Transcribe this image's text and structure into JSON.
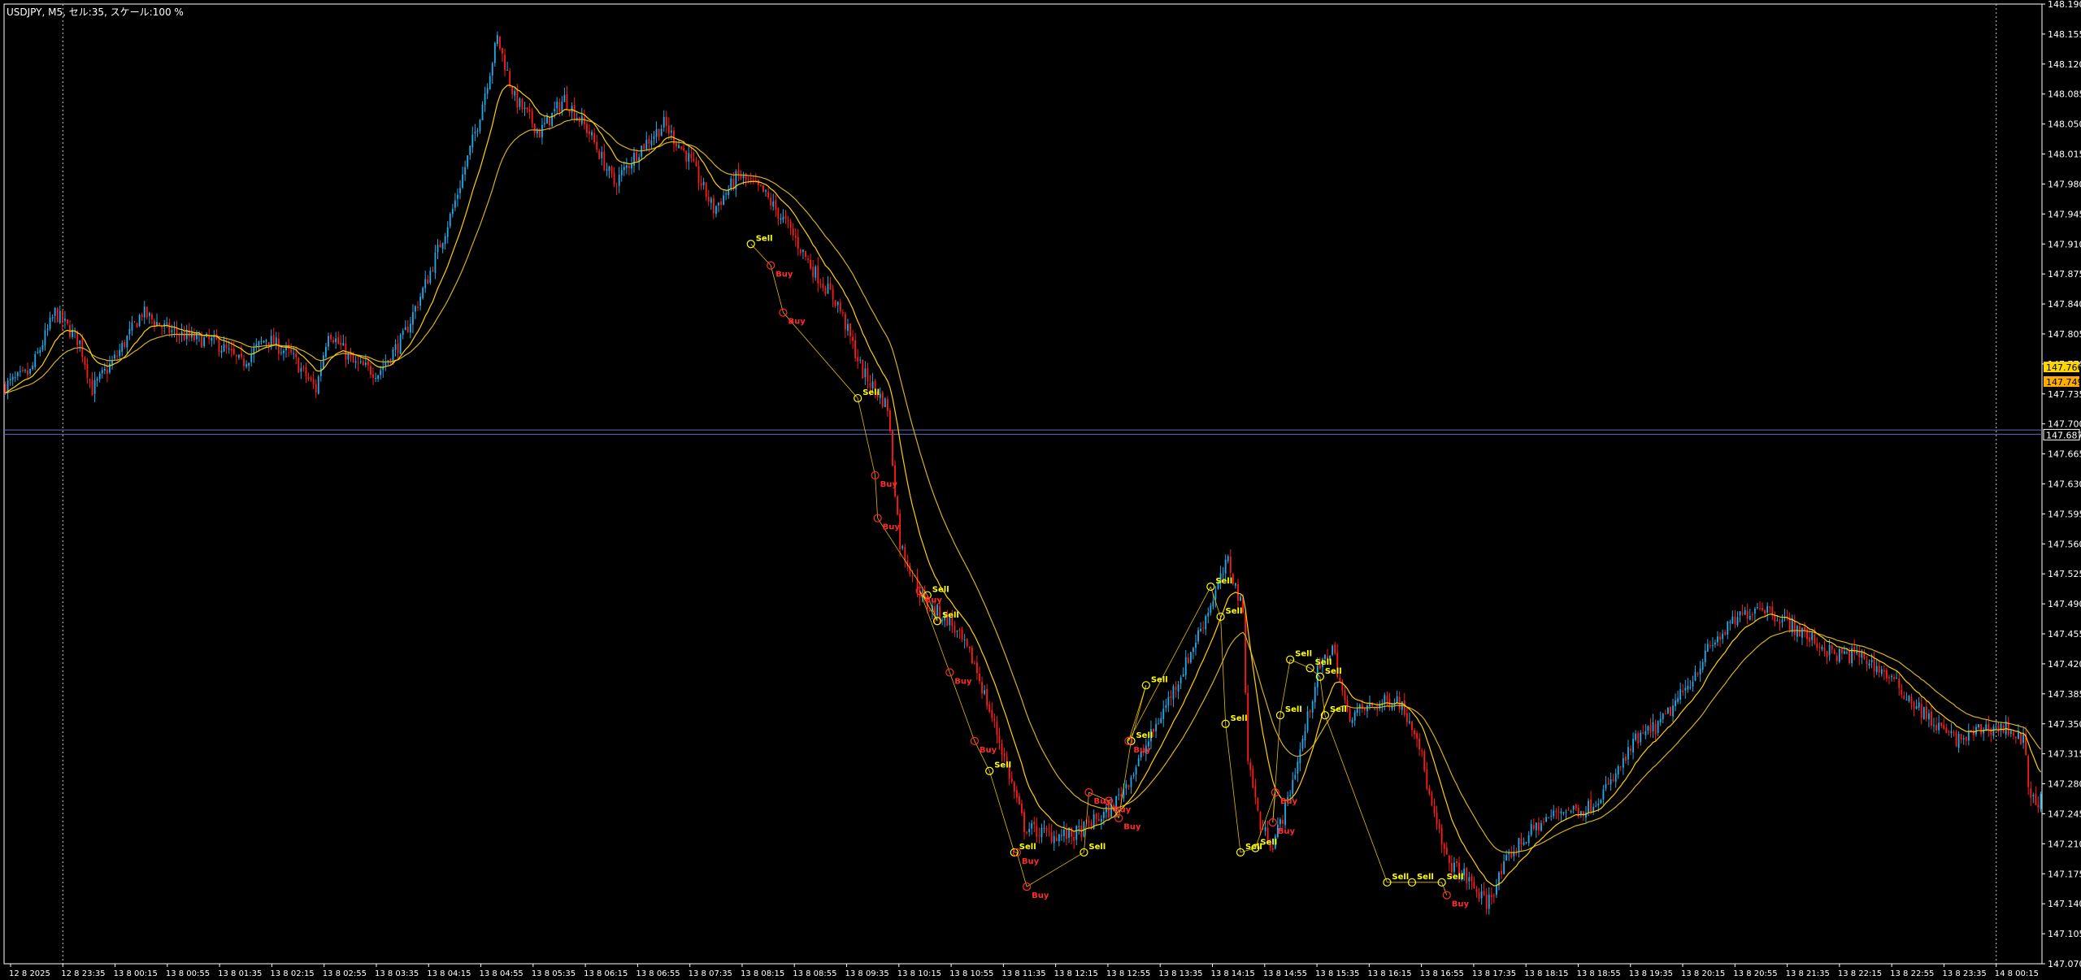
{
  "window": {
    "info_label": "USDJPY, M5, セル:35, スケール:100 %"
  },
  "colors": {
    "background": "#000000",
    "axis": "#ffffff",
    "bull": "#21a9e8",
    "bear": "#ff1a1a",
    "ma_fast": "#ffd000",
    "ma_slow": "#d4b020",
    "signal_sell": "#ffff00",
    "signal_buy": "#ff2a2a",
    "hline": "#5a6bc8",
    "price_tag_1": "#ffd700",
    "price_tag_2": "#ffae00"
  },
  "chart_data": {
    "type": "candlestick",
    "symbol": "USDJPY",
    "timeframe": "M5",
    "ylim": [
      147.07,
      148.19
    ],
    "y_ticks": [
      "148.190",
      "148.155",
      "148.120",
      "148.085",
      "148.050",
      "148.015",
      "147.980",
      "147.945",
      "147.910",
      "147.875",
      "147.840",
      "147.805",
      "147.770",
      "147.735",
      "147.700",
      "147.665",
      "147.630",
      "147.595",
      "147.560",
      "147.525",
      "147.490",
      "147.455",
      "147.420",
      "147.385",
      "147.350",
      "147.315",
      "147.280",
      "147.245",
      "147.210",
      "147.175",
      "147.140",
      "147.105",
      "147.070"
    ],
    "x_ticks": [
      "12 8 2025",
      "12 8 23:35",
      "13 8 00:15",
      "13 8 00:55",
      "13 8 01:35",
      "13 8 02:15",
      "13 8 02:55",
      "13 8 03:35",
      "13 8 04:15",
      "13 8 04:55",
      "13 8 05:35",
      "13 8 06:15",
      "13 8 06:55",
      "13 8 07:35",
      "13 8 08:15",
      "13 8 08:55",
      "13 8 09:35",
      "13 8 10:15",
      "13 8 10:55",
      "13 8 11:35",
      "13 8 12:15",
      "13 8 12:55",
      "13 8 13:35",
      "13 8 14:15",
      "13 8 14:55",
      "13 8 15:35",
      "13 8 16:15",
      "13 8 16:55",
      "13 8 17:35",
      "13 8 18:15",
      "13 8 18:55",
      "13 8 19:35",
      "13 8 20:15",
      "13 8 20:55",
      "13 8 21:35",
      "13 8 22:15",
      "13 8 22:55",
      "13 8 23:35",
      "14 8 00:15"
    ],
    "close_path": [
      [
        0,
        147.745
      ],
      [
        10,
        147.76
      ],
      [
        20,
        147.83
      ],
      [
        30,
        147.795
      ],
      [
        35,
        147.74
      ],
      [
        45,
        147.78
      ],
      [
        55,
        147.83
      ],
      [
        65,
        147.81
      ],
      [
        75,
        147.8
      ],
      [
        85,
        147.795
      ],
      [
        95,
        147.77
      ],
      [
        105,
        147.8
      ],
      [
        115,
        147.78
      ],
      [
        125,
        147.74
      ],
      [
        130,
        147.81
      ],
      [
        140,
        147.77
      ],
      [
        150,
        147.76
      ],
      [
        160,
        147.8
      ],
      [
        170,
        147.87
      ],
      [
        180,
        147.95
      ],
      [
        190,
        148.05
      ],
      [
        198,
        148.15
      ],
      [
        205,
        148.08
      ],
      [
        215,
        148.04
      ],
      [
        225,
        148.08
      ],
      [
        235,
        148.04
      ],
      [
        245,
        147.98
      ],
      [
        255,
        148.02
      ],
      [
        265,
        148.05
      ],
      [
        275,
        148.01
      ],
      [
        285,
        147.95
      ],
      [
        295,
        147.99
      ],
      [
        305,
        147.97
      ],
      [
        315,
        147.93
      ],
      [
        325,
        147.88
      ],
      [
        335,
        147.84
      ],
      [
        345,
        147.76
      ],
      [
        355,
        147.72
      ],
      [
        360,
        147.56
      ],
      [
        370,
        147.49
      ],
      [
        380,
        147.47
      ],
      [
        390,
        147.42
      ],
      [
        400,
        147.33
      ],
      [
        410,
        147.23
      ],
      [
        420,
        147.22
      ],
      [
        430,
        147.22
      ],
      [
        445,
        147.25
      ],
      [
        455,
        147.3
      ],
      [
        465,
        147.36
      ],
      [
        475,
        147.42
      ],
      [
        485,
        147.49
      ],
      [
        492,
        147.54
      ],
      [
        498,
        147.48
      ],
      [
        500,
        147.31
      ],
      [
        505,
        147.23
      ],
      [
        510,
        147.21
      ],
      [
        515,
        147.25
      ],
      [
        522,
        147.33
      ],
      [
        528,
        147.41
      ],
      [
        534,
        147.44
      ],
      [
        540,
        147.36
      ],
      [
        550,
        147.37
      ],
      [
        560,
        147.38
      ],
      [
        568,
        147.34
      ],
      [
        574,
        147.25
      ],
      [
        580,
        147.19
      ],
      [
        588,
        147.17
      ],
      [
        596,
        147.14
      ],
      [
        606,
        147.2
      ],
      [
        616,
        147.23
      ],
      [
        626,
        147.25
      ],
      [
        636,
        147.25
      ],
      [
        646,
        147.28
      ],
      [
        656,
        147.33
      ],
      [
        666,
        147.35
      ],
      [
        676,
        147.39
      ],
      [
        686,
        147.44
      ],
      [
        696,
        147.47
      ],
      [
        706,
        147.49
      ],
      [
        716,
        147.47
      ],
      [
        726,
        147.45
      ],
      [
        736,
        147.43
      ],
      [
        746,
        147.43
      ],
      [
        756,
        147.41
      ],
      [
        766,
        147.38
      ],
      [
        776,
        147.35
      ],
      [
        786,
        147.33
      ],
      [
        796,
        147.345
      ],
      [
        806,
        147.345
      ],
      [
        812,
        147.33
      ],
      [
        815,
        147.26
      ]
    ],
    "signals": [
      {
        "type": "Sell",
        "label": "Sell",
        "i": 300,
        "price": 147.91
      },
      {
        "type": "Buy",
        "label": "Buy",
        "i": 308,
        "price": 147.885
      },
      {
        "type": "Buy",
        "label": "Buy",
        "i": 313,
        "price": 147.83
      },
      {
        "type": "Sell",
        "label": "Sell",
        "i": 343,
        "price": 147.73
      },
      {
        "type": "Buy",
        "label": "Buy",
        "i": 350,
        "price": 147.64
      },
      {
        "type": "Buy",
        "label": "Buy",
        "i": 351,
        "price": 147.59
      },
      {
        "type": "Sell",
        "label": "Sell",
        "i": 371,
        "price": 147.5
      },
      {
        "type": "Sell",
        "label": "Sell",
        "i": 375,
        "price": 147.47
      },
      {
        "type": "Buy",
        "label": "Buy",
        "i": 368,
        "price": 147.505
      },
      {
        "type": "Buy",
        "label": "Buy",
        "i": 380,
        "price": 147.41
      },
      {
        "type": "Buy",
        "label": "Buy",
        "i": 390,
        "price": 147.33
      },
      {
        "type": "Sell",
        "label": "Sell",
        "i": 396,
        "price": 147.295
      },
      {
        "type": "Sell",
        "label": "Sell",
        "i": 406,
        "price": 147.2
      },
      {
        "type": "Buy",
        "label": "Buy",
        "i": 407,
        "price": 147.2
      },
      {
        "type": "Buy",
        "label": "Buy",
        "i": 411,
        "price": 147.16
      },
      {
        "type": "Sell",
        "label": "Sell",
        "i": 434,
        "price": 147.2
      },
      {
        "type": "Buy",
        "label": "Buy",
        "i": 436,
        "price": 147.27
      },
      {
        "type": "Buy",
        "label": "Buy",
        "i": 444,
        "price": 147.26
      },
      {
        "type": "Buy",
        "label": "Buy",
        "i": 448,
        "price": 147.24
      },
      {
        "type": "Sell",
        "label": "Sell",
        "i": 453,
        "price": 147.33
      },
      {
        "type": "Sell",
        "label": "Sell",
        "i": 459,
        "price": 147.395
      },
      {
        "type": "Buy",
        "label": "Buy",
        "i": 452,
        "price": 147.33
      },
      {
        "type": "Sell",
        "label": "Sell",
        "i": 485,
        "price": 147.51
      },
      {
        "type": "Sell",
        "label": "Sell",
        "i": 489,
        "price": 147.475
      },
      {
        "type": "Sell",
        "label": "Sell",
        "i": 491,
        "price": 147.35
      },
      {
        "type": "Sell",
        "label": "Sell",
        "i": 497,
        "price": 147.2
      },
      {
        "type": "Sell",
        "label": "Sell",
        "i": 503,
        "price": 147.205
      },
      {
        "type": "Buy",
        "label": "Buy",
        "i": 511,
        "price": 147.27
      },
      {
        "type": "Buy",
        "label": "Buy",
        "i": 510,
        "price": 147.235
      },
      {
        "type": "Sell",
        "label": "Sell",
        "i": 513,
        "price": 147.36
      },
      {
        "type": "Sell",
        "label": "Sell",
        "i": 517,
        "price": 147.425
      },
      {
        "type": "Sell",
        "label": "Sell",
        "i": 525,
        "price": 147.415
      },
      {
        "type": "Sell",
        "label": "Sell",
        "i": 529,
        "price": 147.405
      },
      {
        "type": "Sell",
        "label": "Sell",
        "i": 531,
        "price": 147.36
      },
      {
        "type": "Sell",
        "label": "Sell",
        "i": 556,
        "price": 147.165
      },
      {
        "type": "Sell",
        "label": "Sell",
        "i": 566,
        "price": 147.165
      },
      {
        "type": "Sell",
        "label": "Sell",
        "i": 578,
        "price": 147.165
      },
      {
        "type": "Buy",
        "label": "Buy",
        "i": 580,
        "price": 147.15
      }
    ],
    "hlines": [
      147.688,
      147.693
    ],
    "vlines_x_ticks": [
      "12 8 23:35",
      "14 8 00:15"
    ],
    "price_tags": [
      {
        "price": 147.766,
        "label": "147.766"
      },
      {
        "price": 147.749,
        "label": "147.749"
      },
      {
        "price": 147.687,
        "label": "147.687"
      }
    ]
  }
}
